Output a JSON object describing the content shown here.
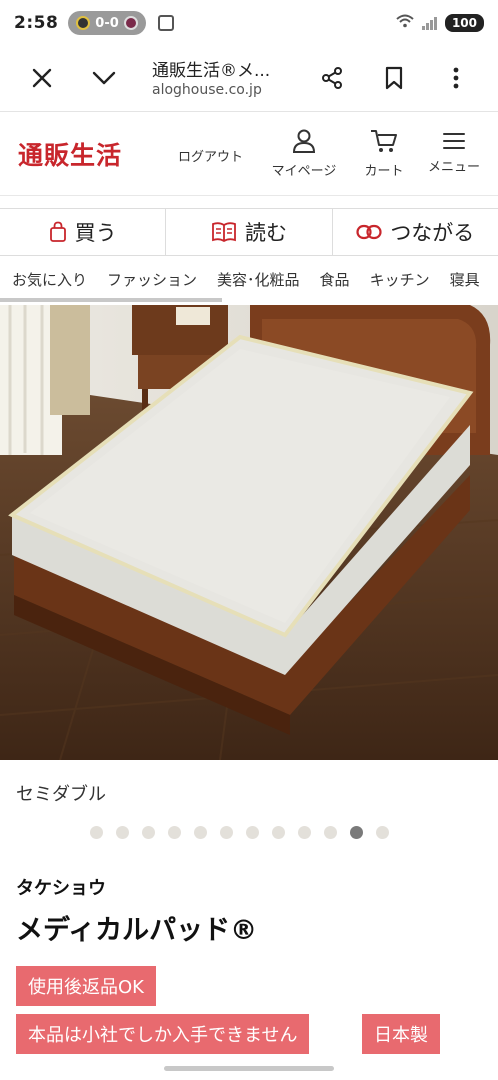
{
  "status_bar": {
    "time": "2:58",
    "score": "0-0",
    "battery": "100"
  },
  "browser": {
    "title": "通販生活®メ...",
    "url": "aloghouse.co.jp"
  },
  "site_header": {
    "logo": "通販生活",
    "logout": "ログアウト",
    "mypage": "マイページ",
    "cart": "カート",
    "menu": "メニュー",
    "brand_color": "#c8262c"
  },
  "tabs": [
    {
      "label": "買う",
      "icon": "shopping-bag-icon"
    },
    {
      "label": "読む",
      "icon": "open-book-icon"
    },
    {
      "label": "つながる",
      "icon": "link-icon"
    }
  ],
  "subnav": [
    "お気に入り",
    "ファッション",
    "美容･化粧品",
    "食品",
    "キッチン",
    "寝具"
  ],
  "product": {
    "image_caption": "セミダブル",
    "carousel": {
      "total": 12,
      "active_index": 10
    },
    "brand": "タケショウ",
    "name": "メディカルパッド®",
    "badges": [
      "使用後返品OK",
      "本品は小社でしか入手できません",
      "日本製"
    ],
    "badge_color": "#e86a6f"
  }
}
